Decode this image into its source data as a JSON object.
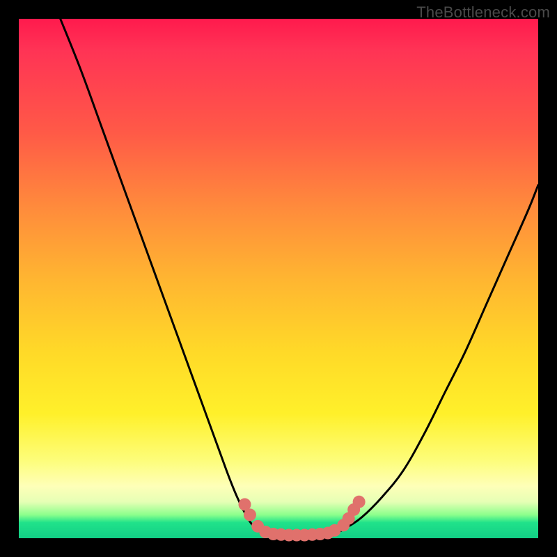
{
  "watermark": "TheBottleneck.com",
  "colors": {
    "frame": "#000000",
    "curve": "#000000",
    "dot_fill": "#e0716c",
    "dot_stroke": "#c8554f",
    "gradient_top": "#ff1a4d",
    "gradient_bottom": "#12cf86"
  },
  "chart_data": {
    "type": "line",
    "title": "",
    "xlabel": "",
    "ylabel": "",
    "xlim": [
      0,
      100
    ],
    "ylim": [
      0,
      100
    ],
    "grid": false,
    "legend": false,
    "note": "Bottleneck-style V-curve. Axes have no visible tick labels; x/y expressed as 0–100 percent of plot area. y = 0 is the bottom (green, best); higher y means worse. Values are estimated from geometry.",
    "series": [
      {
        "name": "left-branch",
        "x": [
          8,
          12,
          16,
          20,
          24,
          28,
          32,
          36,
          40,
          42,
          44,
          45.5,
          47
        ],
        "y": [
          100,
          90,
          79,
          68,
          57,
          46,
          35,
          24,
          13,
          8,
          4,
          2,
          1
        ]
      },
      {
        "name": "valley-floor",
        "x": [
          47,
          49,
          51,
          53,
          55,
          57,
          59,
          61
        ],
        "y": [
          1,
          0.5,
          0.4,
          0.4,
          0.4,
          0.5,
          0.7,
          1
        ]
      },
      {
        "name": "right-branch",
        "x": [
          61,
          63,
          66,
          70,
          74,
          78,
          82,
          86,
          90,
          94,
          98,
          100
        ],
        "y": [
          1,
          2,
          4,
          8,
          13,
          20,
          28,
          36,
          45,
          54,
          63,
          68
        ]
      }
    ],
    "markers": {
      "name": "highlight-dots",
      "note": "Salmon dots clustered around the valley near y≈0–7.",
      "points": [
        {
          "x": 43.5,
          "y": 6.5
        },
        {
          "x": 44.5,
          "y": 4.5
        },
        {
          "x": 46.0,
          "y": 2.3
        },
        {
          "x": 47.5,
          "y": 1.2
        },
        {
          "x": 49.0,
          "y": 0.8
        },
        {
          "x": 50.5,
          "y": 0.7
        },
        {
          "x": 52.0,
          "y": 0.6
        },
        {
          "x": 53.5,
          "y": 0.6
        },
        {
          "x": 55.0,
          "y": 0.6
        },
        {
          "x": 56.5,
          "y": 0.7
        },
        {
          "x": 58.0,
          "y": 0.8
        },
        {
          "x": 59.5,
          "y": 1.0
        },
        {
          "x": 60.8,
          "y": 1.5
        },
        {
          "x": 62.5,
          "y": 2.5
        },
        {
          "x": 63.5,
          "y": 3.8
        },
        {
          "x": 64.5,
          "y": 5.5
        },
        {
          "x": 65.5,
          "y": 7.0
        }
      ]
    }
  }
}
